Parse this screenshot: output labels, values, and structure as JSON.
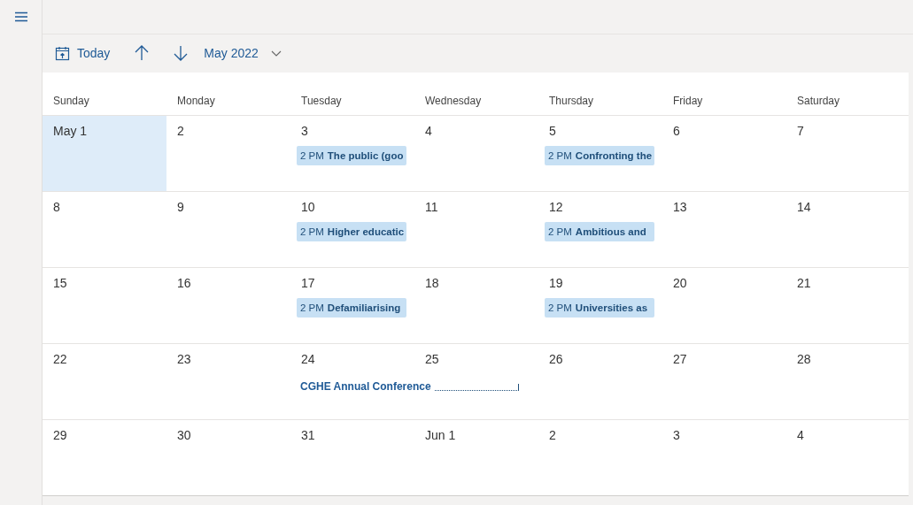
{
  "toolbar": {
    "today": "Today",
    "month": "May 2022"
  },
  "weekdays": [
    "Sunday",
    "Monday",
    "Tuesday",
    "Wednesday",
    "Thursday",
    "Friday",
    "Saturday"
  ],
  "weeks": [
    {
      "days": [
        {
          "label": "May 1",
          "selected": true
        },
        {
          "label": "2",
          "selected": false
        },
        {
          "label": "3",
          "selected": false,
          "events": [
            {
              "kind": "timed",
              "time": "2 PM",
              "title": "The public (goo"
            }
          ]
        },
        {
          "label": "4",
          "selected": false
        },
        {
          "label": "5",
          "selected": false,
          "events": [
            {
              "kind": "timed",
              "time": "2 PM",
              "title": "Confronting the"
            }
          ]
        },
        {
          "label": "6",
          "selected": false
        },
        {
          "label": "7",
          "selected": false
        }
      ]
    },
    {
      "days": [
        {
          "label": "8",
          "selected": false
        },
        {
          "label": "9",
          "selected": false
        },
        {
          "label": "10",
          "selected": false,
          "events": [
            {
              "kind": "timed",
              "time": "2 PM",
              "title": "Higher educatic"
            }
          ]
        },
        {
          "label": "11",
          "selected": false
        },
        {
          "label": "12",
          "selected": false,
          "events": [
            {
              "kind": "timed",
              "time": "2 PM",
              "title": "Ambitious and"
            }
          ]
        },
        {
          "label": "13",
          "selected": false
        },
        {
          "label": "14",
          "selected": false
        }
      ]
    },
    {
      "days": [
        {
          "label": "15",
          "selected": false
        },
        {
          "label": "16",
          "selected": false
        },
        {
          "label": "17",
          "selected": false,
          "events": [
            {
              "kind": "timed",
              "time": "2 PM",
              "title": "Defamiliarising"
            }
          ]
        },
        {
          "label": "18",
          "selected": false
        },
        {
          "label": "19",
          "selected": false,
          "events": [
            {
              "kind": "timed",
              "time": "2 PM",
              "title": "Universities as"
            }
          ]
        },
        {
          "label": "20",
          "selected": false
        },
        {
          "label": "21",
          "selected": false
        }
      ]
    },
    {
      "days": [
        {
          "label": "22",
          "selected": false
        },
        {
          "label": "23",
          "selected": false
        },
        {
          "label": "24",
          "selected": false,
          "events": [
            {
              "kind": "multi_day",
              "title": "CGHE Annual Conference"
            }
          ]
        },
        {
          "label": "25",
          "selected": false
        },
        {
          "label": "26",
          "selected": false
        },
        {
          "label": "27",
          "selected": false
        },
        {
          "label": "28",
          "selected": false
        }
      ]
    },
    {
      "days": [
        {
          "label": "29",
          "selected": false
        },
        {
          "label": "30",
          "selected": false
        },
        {
          "label": "31",
          "selected": false
        },
        {
          "label": "Jun 1",
          "selected": false
        },
        {
          "label": "2",
          "selected": false
        },
        {
          "label": "3",
          "selected": false
        },
        {
          "label": "4",
          "selected": false
        }
      ]
    }
  ]
}
